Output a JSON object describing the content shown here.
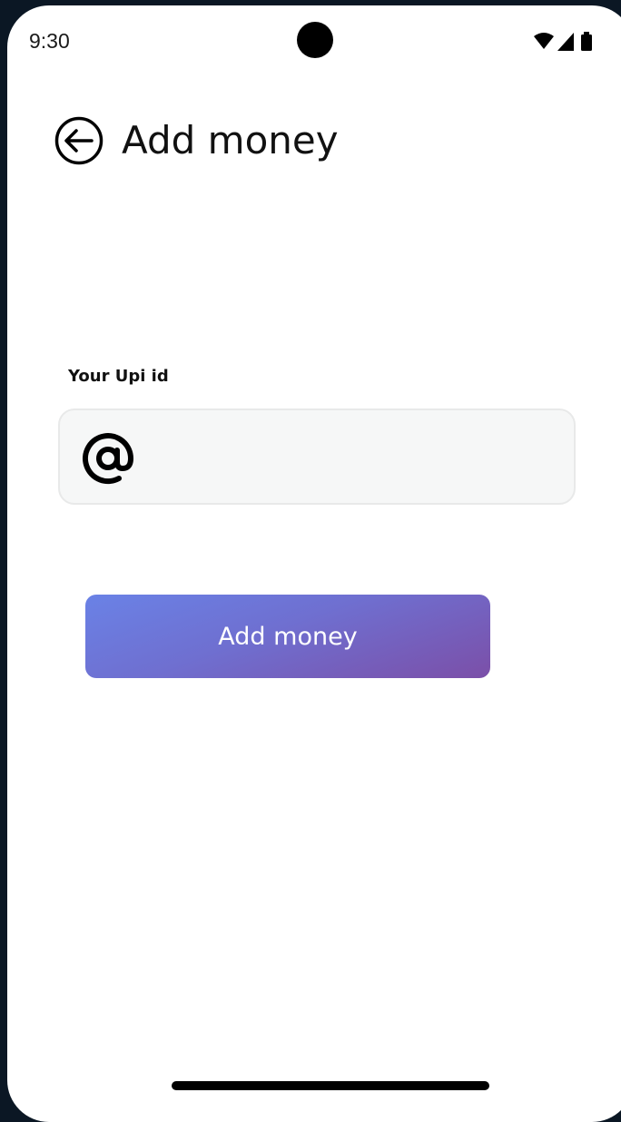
{
  "status_bar": {
    "time": "9:30"
  },
  "header": {
    "title": "Add money",
    "back_icon": "arrow-left-circle-icon"
  },
  "upi": {
    "label": "Your Upi id",
    "value": "",
    "placeholder": "",
    "icon": "at-sign-icon"
  },
  "actions": {
    "add_money_label": "Add money"
  },
  "colors": {
    "button_gradient_start": "#6a82e6",
    "button_gradient_end": "#7b4fa8",
    "field_background": "#f6f7f7"
  }
}
